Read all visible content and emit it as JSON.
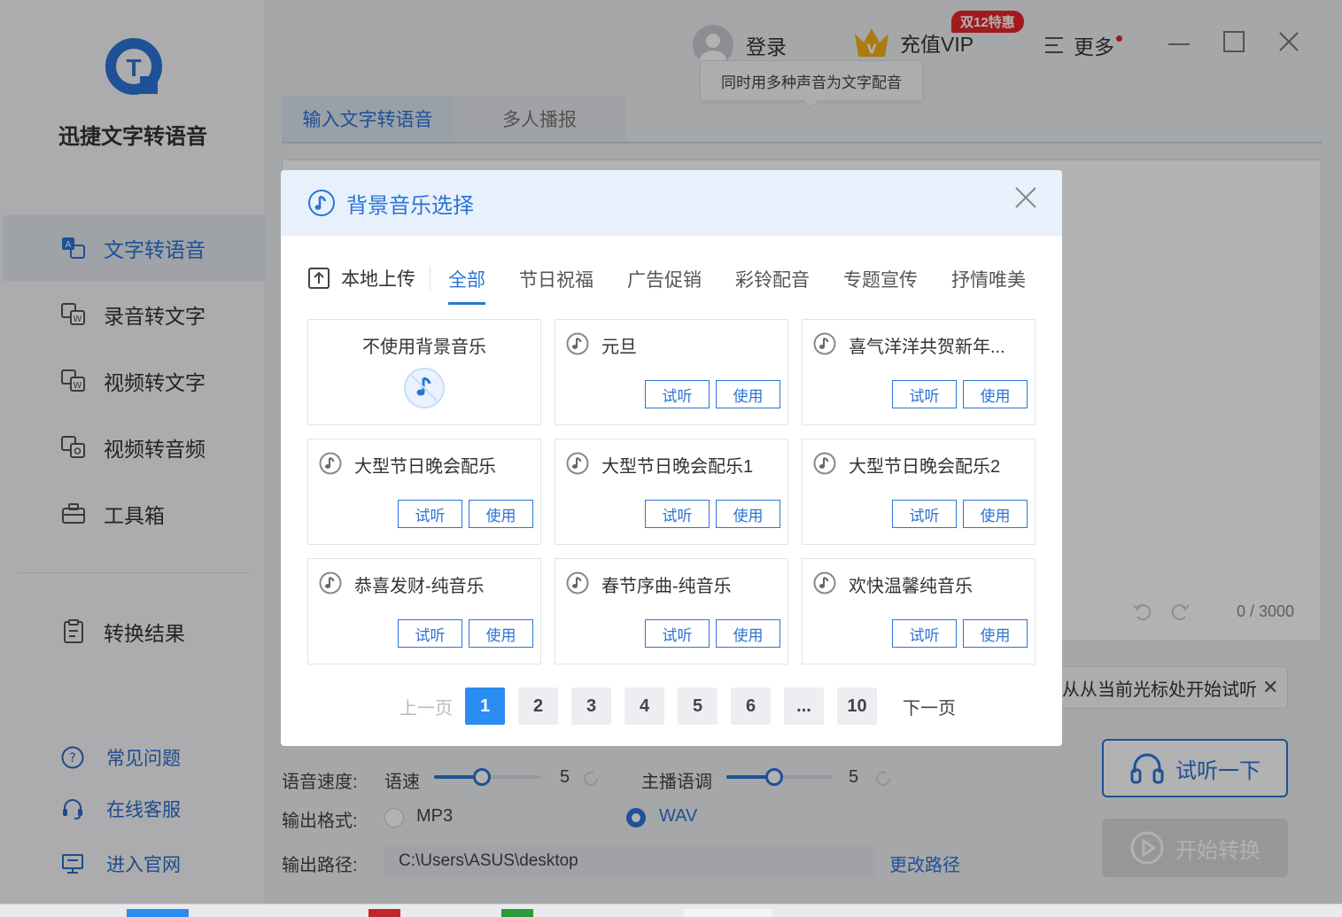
{
  "app": {
    "name": "迅捷文字转语音"
  },
  "sidebar": {
    "items": [
      {
        "label": "文字转语音",
        "icon": "text-to-speech-icon",
        "active": true
      },
      {
        "label": "录音转文字",
        "icon": "audio-to-text-icon",
        "active": false
      },
      {
        "label": "视频转文字",
        "icon": "video-to-text-icon",
        "active": false
      },
      {
        "label": "视频转音频",
        "icon": "video-to-audio-icon",
        "active": false
      },
      {
        "label": "工具箱",
        "icon": "toolbox-icon",
        "active": false
      }
    ],
    "results": "转换结果",
    "footer": [
      {
        "label": "常见问题",
        "icon": "help-icon"
      },
      {
        "label": "在线客服",
        "icon": "headset-icon"
      },
      {
        "label": "进入官网",
        "icon": "monitor-icon"
      }
    ]
  },
  "header": {
    "login": "登录",
    "vip": "充值VIP",
    "promo": "双12特惠",
    "more": "更多",
    "tooltip": "同时用多种声音为文字配音"
  },
  "main": {
    "tabs": [
      "输入文字转语音",
      "多人播报"
    ],
    "counter": "0 / 3000",
    "hint": "从从当前光标处开始试听",
    "speed_label": "语音速度:",
    "speed_name": "语速",
    "speed_value": "5",
    "pitch_label": "主播语调",
    "pitch_value": "5",
    "format_label": "输出格式:",
    "format_options": [
      "MP3",
      "WAV"
    ],
    "format_selected": "WAV",
    "path_label": "输出路径:",
    "path_value": "C:\\Users\\ASUS\\desktop",
    "change_path": "更改路径",
    "listen_button": "试听一下",
    "start_button": "开始转换"
  },
  "modal": {
    "title": "背景音乐选择",
    "upload": "本地上传",
    "categories": [
      "全部",
      "节日祝福",
      "广告促销",
      "彩铃配音",
      "专题宣传",
      "抒情唯美"
    ],
    "active_category": "全部",
    "no_music": "不使用背景音乐",
    "preview_label": "试听",
    "use_label": "使用",
    "tracks": [
      "元旦",
      "喜气洋洋共贺新年...",
      "大型节日晚会配乐",
      "大型节日晚会配乐1",
      "大型节日晚会配乐2",
      "恭喜发财-纯音乐",
      "春节序曲-纯音乐",
      "欢快温馨纯音乐"
    ],
    "pager": {
      "prev": "上一页",
      "next": "下一页",
      "pages": [
        "1",
        "2",
        "3",
        "4",
        "5",
        "6",
        "...",
        "10"
      ],
      "current": "1"
    }
  },
  "colors": {
    "accent": "#2b74d6",
    "promo": "#e8262b",
    "page_active": "#2b8cf2"
  }
}
